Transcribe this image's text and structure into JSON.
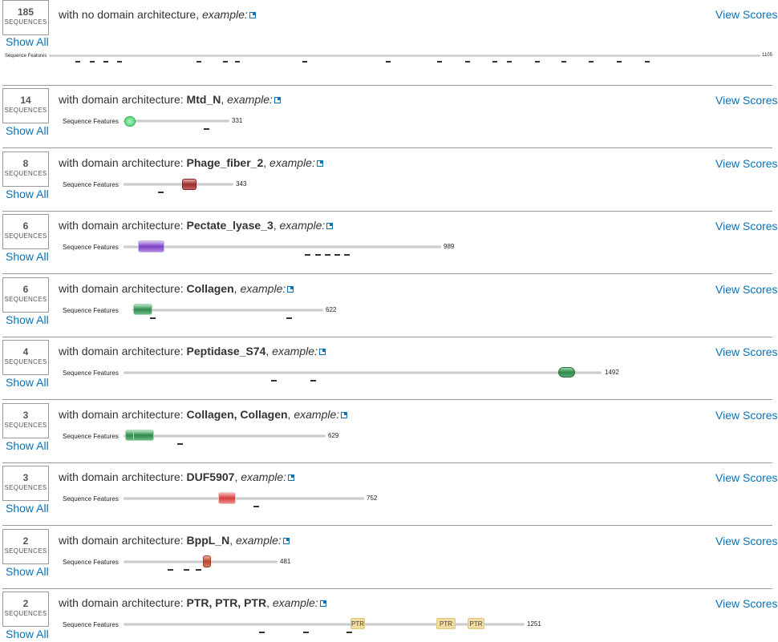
{
  "sequences_label": "SEQUENCES",
  "show_all_label": "Show All",
  "view_scores_label": "View Scores",
  "seq_features_label": "Sequence Features",
  "example_label": "example:",
  "architectures": [
    {
      "count": "185",
      "prefix": "with no domain architecture",
      "name": "",
      "length": "1105"
    },
    {
      "count": "14",
      "prefix": "with domain architecture: ",
      "name": "Mtd_N",
      "length": "331"
    },
    {
      "count": "8",
      "prefix": "with domain architecture: ",
      "name": "Phage_fiber_2",
      "length": "343"
    },
    {
      "count": "6",
      "prefix": "with domain architecture: ",
      "name": "Pectate_lyase_3",
      "length": "989"
    },
    {
      "count": "6",
      "prefix": "with domain architecture: ",
      "name": "Collagen",
      "length": "622"
    },
    {
      "count": "4",
      "prefix": "with domain architecture: ",
      "name": "Peptidase_S74",
      "length": "1492"
    },
    {
      "count": "3",
      "prefix": "with domain architecture: ",
      "name": "Collagen, Collagen",
      "length": "629"
    },
    {
      "count": "3",
      "prefix": "with domain architecture: ",
      "name": "DUF5907",
      "length": "752"
    },
    {
      "count": "2",
      "prefix": "with domain architecture: ",
      "name": "BppL_N",
      "length": "481"
    },
    {
      "count": "2",
      "prefix": "with domain architecture: ",
      "name": "PTR, PTR, PTR",
      "length": "1251",
      "ptr_labels": [
        "PTR",
        "PTR",
        "PTR"
      ]
    }
  ],
  "domain_colors": {
    "Mtd_N": "#3ecf6a",
    "Phage_fiber_2": "#9b2b2b",
    "Pectate_lyase_3": "#7b3fc4",
    "Collagen": "#2e8b4a",
    "Peptidase_S74": "#2e8b4a",
    "DUF5907": "#d83c3c",
    "BppL_N": "#b8452a",
    "PTR": "#f1dca0"
  },
  "link_color": "#0a72b5"
}
